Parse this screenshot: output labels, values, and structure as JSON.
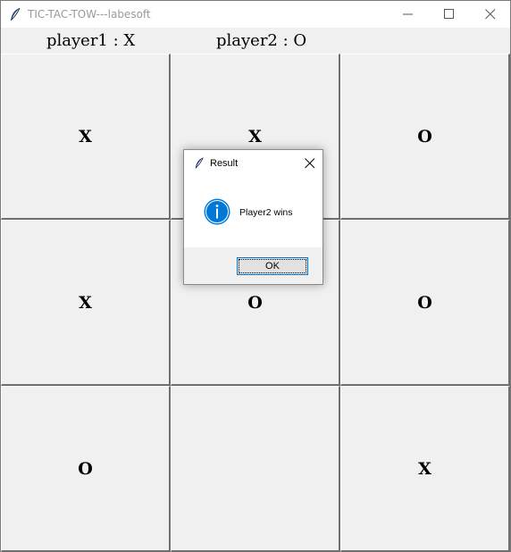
{
  "window": {
    "title": "TIC-TAC-TOW---labesoft",
    "icon": "feather-icon"
  },
  "header": {
    "player1_label": "player1 : X",
    "player2_label": "player2 : O"
  },
  "board": {
    "cells": [
      "X",
      "X",
      "O",
      "X",
      "O",
      "O",
      "O",
      "",
      "X"
    ]
  },
  "dialog": {
    "title": "Result",
    "icon": "info-icon",
    "message": "Player2 wins",
    "ok_label": "OK",
    "accent_color": "#0078d7"
  }
}
